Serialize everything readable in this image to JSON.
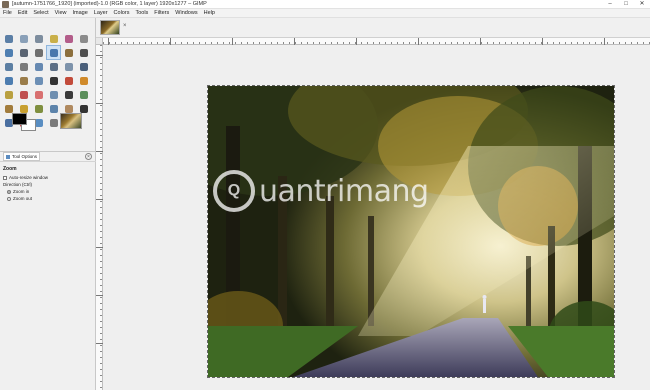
{
  "window": {
    "title": "[autumn-1751766_1920] (imported)-1.0 (RGB color, 1 layer) 1920x1277 – GIMP",
    "controls": {
      "minimize": "–",
      "maximize": "□",
      "close": "✕"
    }
  },
  "menu": [
    "File",
    "Edit",
    "Select",
    "View",
    "Image",
    "Layer",
    "Colors",
    "Tools",
    "Filters",
    "Windows",
    "Help"
  ],
  "toolbox": {
    "tools": [
      {
        "name": "rect-select-icon",
        "color": "#5b7fa6"
      },
      {
        "name": "ellipse-select-icon",
        "color": "#8aa0b8"
      },
      {
        "name": "free-select-icon",
        "color": "#7d8d9e"
      },
      {
        "name": "fuzzy-select-icon",
        "color": "#c9b04a"
      },
      {
        "name": "select-by-color-icon",
        "color": "#b35d8a"
      },
      {
        "name": "scissors-select-icon",
        "color": "#8b8b8b"
      },
      {
        "name": "foreground-select-icon",
        "color": "#4f7fb1"
      },
      {
        "name": "paths-icon",
        "color": "#5a6472"
      },
      {
        "name": "color-picker-icon",
        "color": "#6f6f6f"
      },
      {
        "name": "zoom-icon",
        "color": "#4a78ad"
      },
      {
        "name": "measure-icon",
        "color": "#8c6f3d"
      },
      {
        "name": "move-icon",
        "color": "#4f4f4f"
      },
      {
        "name": "align-icon",
        "color": "#5c7fa3"
      },
      {
        "name": "crop-icon",
        "color": "#7a7a7a"
      },
      {
        "name": "rotate-icon",
        "color": "#6689b1"
      },
      {
        "name": "scale-icon",
        "color": "#5c6f86"
      },
      {
        "name": "shear-icon",
        "color": "#7d93ab"
      },
      {
        "name": "perspective-icon",
        "color": "#4a5f7a"
      },
      {
        "name": "flip-icon",
        "color": "#4d7db0"
      },
      {
        "name": "cage-icon",
        "color": "#9a7c49"
      },
      {
        "name": "warp-icon",
        "color": "#6c8fb5"
      },
      {
        "name": "text-icon",
        "color": "#333333"
      },
      {
        "name": "bucket-fill-icon",
        "color": "#c24b3a"
      },
      {
        "name": "blend-icon",
        "color": "#d08a2a"
      },
      {
        "name": "pencil-icon",
        "color": "#b9a040"
      },
      {
        "name": "paintbrush-icon",
        "color": "#c05050"
      },
      {
        "name": "eraser-icon",
        "color": "#d87070"
      },
      {
        "name": "airbrush-icon",
        "color": "#6f8fb0"
      },
      {
        "name": "ink-icon",
        "color": "#3a3a3a"
      },
      {
        "name": "mypaint-brush-icon",
        "color": "#5b8f5b"
      },
      {
        "name": "clone-icon",
        "color": "#a27c3c"
      },
      {
        "name": "heal-icon",
        "color": "#c8a030"
      },
      {
        "name": "perspective-clone-icon",
        "color": "#7f8f3f"
      },
      {
        "name": "blur-icon",
        "color": "#5d84ab"
      },
      {
        "name": "smudge-icon",
        "color": "#b08a60"
      },
      {
        "name": "dodge-burn-icon",
        "color": "#333333"
      },
      {
        "name": "color-tool-a-icon",
        "color": "#4a6fa0"
      },
      {
        "name": "color-tool-b-icon",
        "color": "#cc3a3a"
      },
      {
        "name": "color-tool-c-icon",
        "color": "#5a8ec2"
      },
      {
        "name": "color-tool-d-icon",
        "color": "#7a7a7a"
      }
    ]
  },
  "colors": {
    "foreground": "#000000",
    "background": "#ffffff"
  },
  "dock": {
    "tab_label": "Tool Options",
    "tool_options": {
      "title": "Zoom",
      "auto_resize_label": "Auto-resize window",
      "direction_label": "Direction  (Ctrl)",
      "zoom_in_label": "Zoom in",
      "zoom_out_label": "Zoom out"
    }
  },
  "image_tab": {
    "close_glyph": "×"
  },
  "watermark": {
    "text": "uantrimang",
    "logo_glyph": "Q"
  }
}
